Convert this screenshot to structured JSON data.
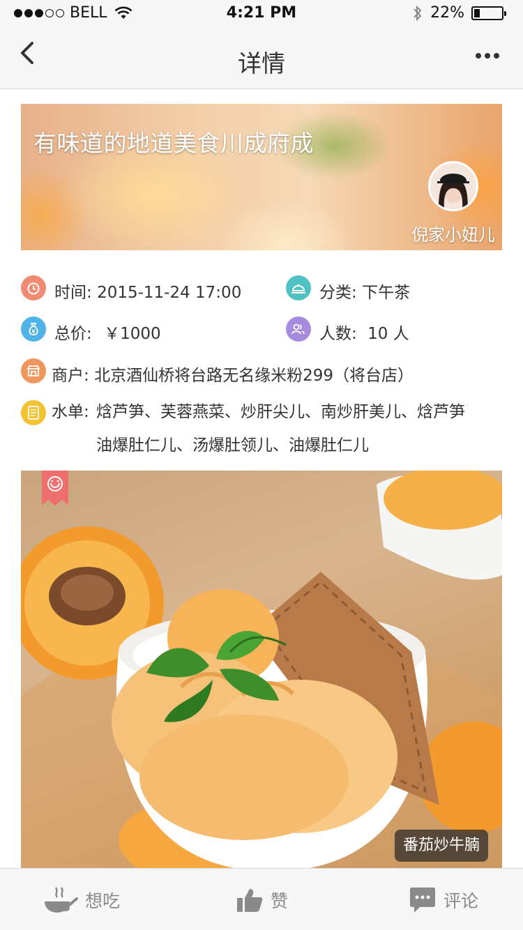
{
  "status_bar": {
    "carrier": "BELL",
    "time": "4:21 PM",
    "battery_text": "22%",
    "battery_level": 0.22,
    "signal_dots_filled": 3,
    "signal_dots_total": 5
  },
  "nav": {
    "title": "详情"
  },
  "hero": {
    "title": "有味道的地道美食川成府成",
    "author": "倪家小妞儿"
  },
  "info": {
    "time_label": "时间:",
    "time_value": "2015-11-24 17:00",
    "category_label": "分类:",
    "category_value": "下午茶",
    "price_label": "总价:",
    "price_value": "￥1000",
    "people_label": "人数:",
    "people_value": "10 人",
    "merchant_label": "商户:",
    "merchant_value": "北京酒仙桥将台路无名缘米粉299（将台店）",
    "menu_label": "水单:",
    "menu_line1": "焓芦笋、芙蓉燕菜、炒肝尖儿、南炒肝美儿、焓芦笋",
    "menu_line2": "油爆肚仁儿、汤爆肚领儿、油爆肚仁儿"
  },
  "photo": {
    "caption": "番茄炒牛腩"
  },
  "tabs": {
    "want": "想吃",
    "like": "赞",
    "comment": "评论"
  },
  "colors": {
    "time_icon": "#f28a74",
    "category_icon": "#4fc1c3",
    "price_icon": "#4fb3e8",
    "people_icon": "#a78bdf",
    "merchant_icon": "#f0975d",
    "menu_icon": "#f3c22f",
    "bookmark": "#ef6e6e"
  }
}
